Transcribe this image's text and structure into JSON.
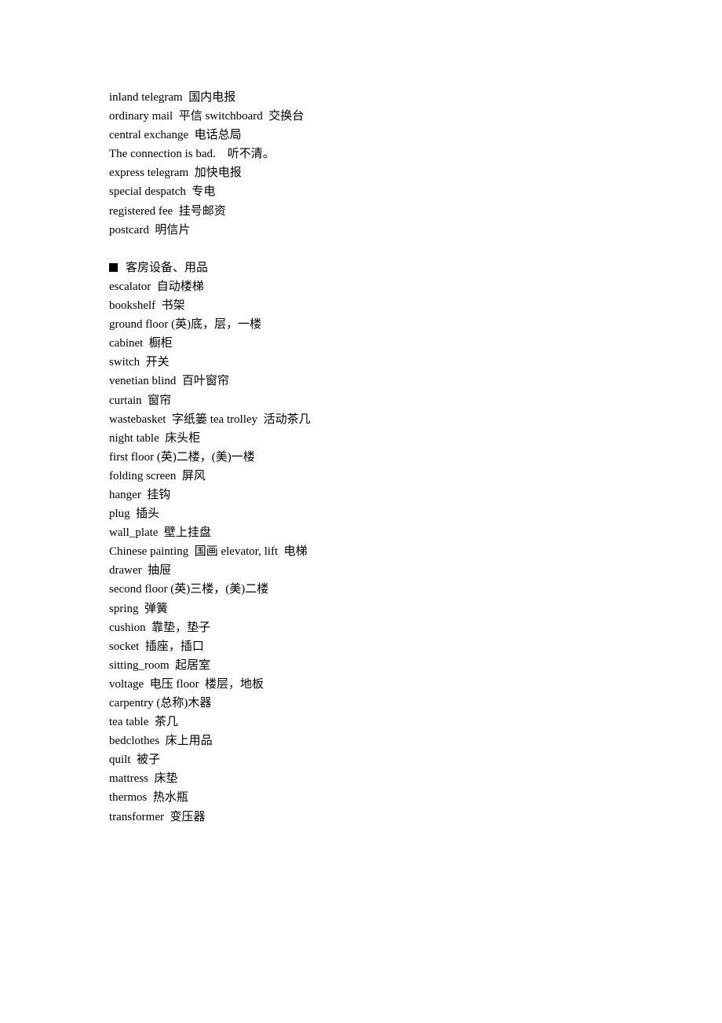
{
  "section1": {
    "lines": [
      "inland telegram  国内电报",
      "ordinary mail  平信 switchboard  交换台",
      "central exchange  电话总局",
      "The connection is bad.    听不清。",
      "express telegram  加快电报",
      "special despatch  专电",
      "registered fee  挂号邮资",
      "postcard  明信片"
    ]
  },
  "section2": {
    "heading_icon": "black-square-bullet",
    "heading": "客房设备、用品",
    "lines": [
      "escalator  自动楼梯",
      "bookshelf  书架",
      "ground floor (英)底，层，一楼",
      "cabinet  橱柜",
      "switch  开关",
      "venetian blind  百叶窗帘",
      "curtain  窗帘",
      "wastebasket  字纸篓 tea trolley  活动茶几",
      "night table  床头柜",
      "first floor (英)二楼，(美)一楼",
      "folding screen  屏风",
      "hanger  挂钩",
      "plug  插头",
      "wall_plate  壁上挂盘",
      "Chinese painting  国画 elevator, lift  电梯",
      "drawer  抽屉",
      "second floor (英)三楼，(美)二楼",
      "spring  弹簧",
      "cushion  靠垫，垫子",
      "socket  插座，插口",
      "sitting_room  起居室",
      "voltage  电压 floor  楼层，地板",
      "carpentry (总称)木器",
      "tea table  茶几",
      "bedclothes  床上用品",
      "quilt  被子",
      "mattress  床垫",
      "thermos  热水瓶",
      "transformer  变压器"
    ]
  }
}
